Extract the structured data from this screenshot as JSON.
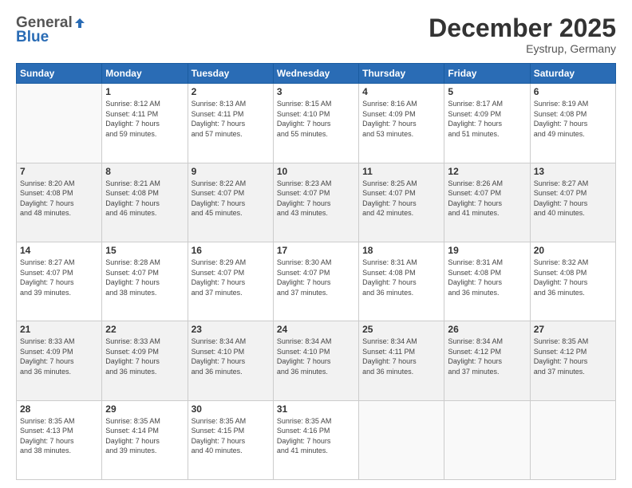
{
  "header": {
    "logo_general": "General",
    "logo_blue": "Blue",
    "month_title": "December 2025",
    "location": "Eystrup, Germany"
  },
  "weekdays": [
    "Sunday",
    "Monday",
    "Tuesday",
    "Wednesday",
    "Thursday",
    "Friday",
    "Saturday"
  ],
  "weeks": [
    [
      {
        "day": "",
        "info": ""
      },
      {
        "day": "1",
        "info": "Sunrise: 8:12 AM\nSunset: 4:11 PM\nDaylight: 7 hours\nand 59 minutes."
      },
      {
        "day": "2",
        "info": "Sunrise: 8:13 AM\nSunset: 4:11 PM\nDaylight: 7 hours\nand 57 minutes."
      },
      {
        "day": "3",
        "info": "Sunrise: 8:15 AM\nSunset: 4:10 PM\nDaylight: 7 hours\nand 55 minutes."
      },
      {
        "day": "4",
        "info": "Sunrise: 8:16 AM\nSunset: 4:09 PM\nDaylight: 7 hours\nand 53 minutes."
      },
      {
        "day": "5",
        "info": "Sunrise: 8:17 AM\nSunset: 4:09 PM\nDaylight: 7 hours\nand 51 minutes."
      },
      {
        "day": "6",
        "info": "Sunrise: 8:19 AM\nSunset: 4:08 PM\nDaylight: 7 hours\nand 49 minutes."
      }
    ],
    [
      {
        "day": "7",
        "info": ""
      },
      {
        "day": "8",
        "info": "Sunrise: 8:21 AM\nSunset: 4:08 PM\nDaylight: 7 hours\nand 46 minutes."
      },
      {
        "day": "9",
        "info": "Sunrise: 8:22 AM\nSunset: 4:07 PM\nDaylight: 7 hours\nand 45 minutes."
      },
      {
        "day": "10",
        "info": "Sunrise: 8:23 AM\nSunset: 4:07 PM\nDaylight: 7 hours\nand 43 minutes."
      },
      {
        "day": "11",
        "info": "Sunrise: 8:25 AM\nSunset: 4:07 PM\nDaylight: 7 hours\nand 42 minutes."
      },
      {
        "day": "12",
        "info": "Sunrise: 8:26 AM\nSunset: 4:07 PM\nDaylight: 7 hours\nand 41 minutes."
      },
      {
        "day": "13",
        "info": "Sunrise: 8:27 AM\nSunset: 4:07 PM\nDaylight: 7 hours\nand 40 minutes."
      }
    ],
    [
      {
        "day": "14",
        "info": ""
      },
      {
        "day": "15",
        "info": "Sunrise: 8:28 AM\nSunset: 4:07 PM\nDaylight: 7 hours\nand 38 minutes."
      },
      {
        "day": "16",
        "info": "Sunrise: 8:29 AM\nSunset: 4:07 PM\nDaylight: 7 hours\nand 37 minutes."
      },
      {
        "day": "17",
        "info": "Sunrise: 8:30 AM\nSunset: 4:07 PM\nDaylight: 7 hours\nand 37 minutes."
      },
      {
        "day": "18",
        "info": "Sunrise: 8:31 AM\nSunset: 4:08 PM\nDaylight: 7 hours\nand 36 minutes."
      },
      {
        "day": "19",
        "info": "Sunrise: 8:31 AM\nSunset: 4:08 PM\nDaylight: 7 hours\nand 36 minutes."
      },
      {
        "day": "20",
        "info": "Sunrise: 8:32 AM\nSunset: 4:08 PM\nDaylight: 7 hours\nand 36 minutes."
      }
    ],
    [
      {
        "day": "21",
        "info": "Sunrise: 8:33 AM\nSunset: 4:09 PM\nDaylight: 7 hours\nand 36 minutes."
      },
      {
        "day": "22",
        "info": "Sunrise: 8:33 AM\nSunset: 4:09 PM\nDaylight: 7 hours\nand 36 minutes."
      },
      {
        "day": "23",
        "info": "Sunrise: 8:34 AM\nSunset: 4:10 PM\nDaylight: 7 hours\nand 36 minutes."
      },
      {
        "day": "24",
        "info": "Sunrise: 8:34 AM\nSunset: 4:10 PM\nDaylight: 7 hours\nand 36 minutes."
      },
      {
        "day": "25",
        "info": "Sunrise: 8:34 AM\nSunset: 4:11 PM\nDaylight: 7 hours\nand 36 minutes."
      },
      {
        "day": "26",
        "info": "Sunrise: 8:34 AM\nSunset: 4:12 PM\nDaylight: 7 hours\nand 37 minutes."
      },
      {
        "day": "27",
        "info": "Sunrise: 8:35 AM\nSunset: 4:12 PM\nDaylight: 7 hours\nand 37 minutes."
      }
    ],
    [
      {
        "day": "28",
        "info": "Sunrise: 8:35 AM\nSunset: 4:13 PM\nDaylight: 7 hours\nand 38 minutes."
      },
      {
        "day": "29",
        "info": "Sunrise: 8:35 AM\nSunset: 4:14 PM\nDaylight: 7 hours\nand 39 minutes."
      },
      {
        "day": "30",
        "info": "Sunrise: 8:35 AM\nSunset: 4:15 PM\nDaylight: 7 hours\nand 40 minutes."
      },
      {
        "day": "31",
        "info": "Sunrise: 8:35 AM\nSunset: 4:16 PM\nDaylight: 7 hours\nand 41 minutes."
      },
      {
        "day": "",
        "info": ""
      },
      {
        "day": "",
        "info": ""
      },
      {
        "day": "",
        "info": ""
      }
    ]
  ]
}
